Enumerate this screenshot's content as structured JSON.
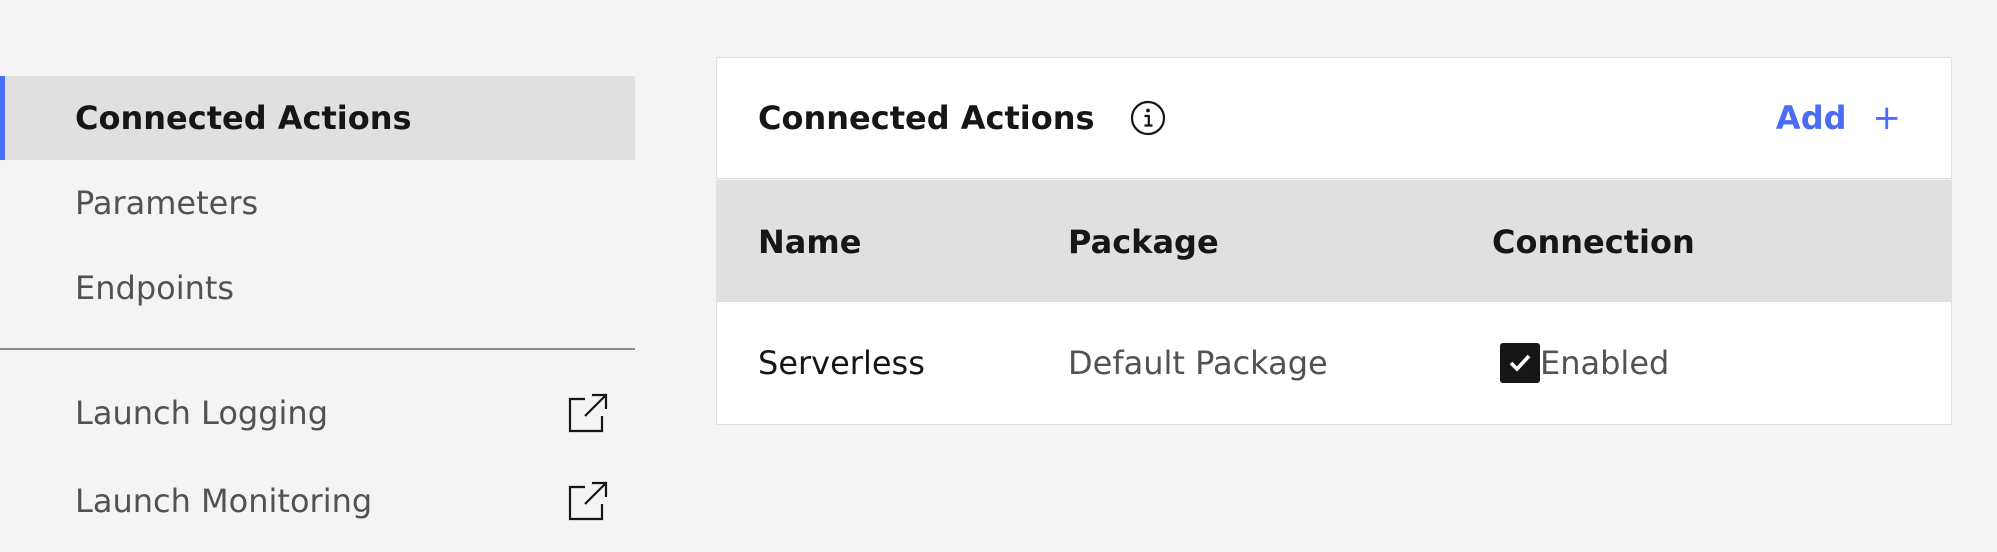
{
  "sidebar": {
    "items": [
      {
        "label": "Connected Actions",
        "active": true
      },
      {
        "label": "Parameters",
        "active": false
      },
      {
        "label": "Endpoints",
        "active": false
      }
    ],
    "launch_items": [
      {
        "label": "Launch Logging",
        "icon": "external-link-icon"
      },
      {
        "label": "Launch Monitoring",
        "icon": "external-link-icon"
      }
    ]
  },
  "card": {
    "title": "Connected Actions",
    "info_icon": "info-icon",
    "add_label": "Add",
    "add_icon": "+"
  },
  "table": {
    "columns": [
      "Name",
      "Package",
      "Connection"
    ],
    "rows": [
      {
        "name": "Serverless",
        "package": "Default Package",
        "connection": "Enabled",
        "checked": true
      }
    ]
  },
  "colors": {
    "accent": "#4a6cf7",
    "background": "#f4f4f4",
    "active_bg": "#e0e0e0",
    "text": "#161616",
    "muted_text": "#525252"
  }
}
